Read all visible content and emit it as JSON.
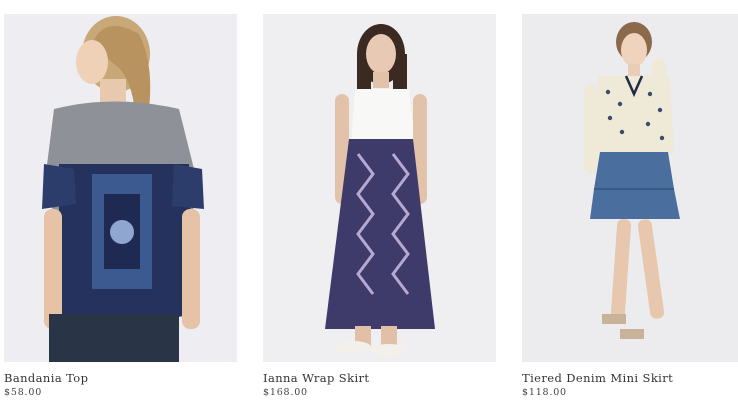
{
  "products": [
    {
      "name": "Bandania Top",
      "price": "$58.00",
      "image": "model-back-bandana-print-top"
    },
    {
      "name": "Ianna Wrap Skirt",
      "price": "$168.00",
      "image": "model-white-tank-printed-maxi-skirt"
    },
    {
      "name": "Tiered Denim Mini Skirt",
      "price": "$118.00",
      "image": "model-printed-blouse-denim-mini-skirt"
    }
  ]
}
